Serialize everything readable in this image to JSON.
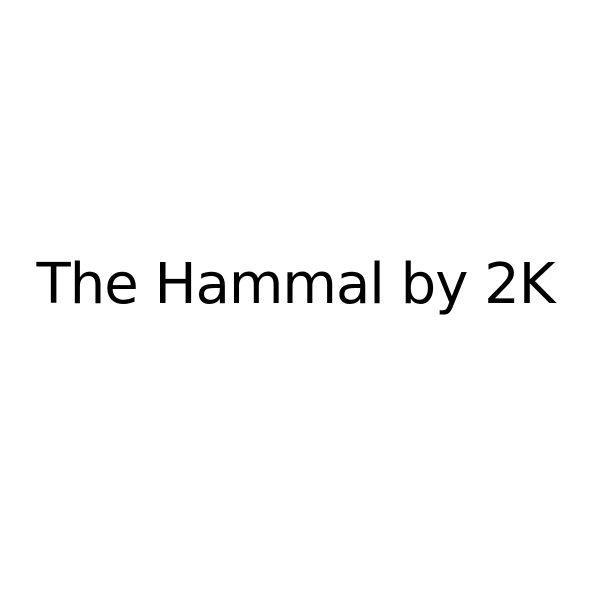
{
  "text": {
    "main": "The Hammal by 2K"
  },
  "colors": {
    "background": "#ffffff",
    "text": "#000000"
  }
}
